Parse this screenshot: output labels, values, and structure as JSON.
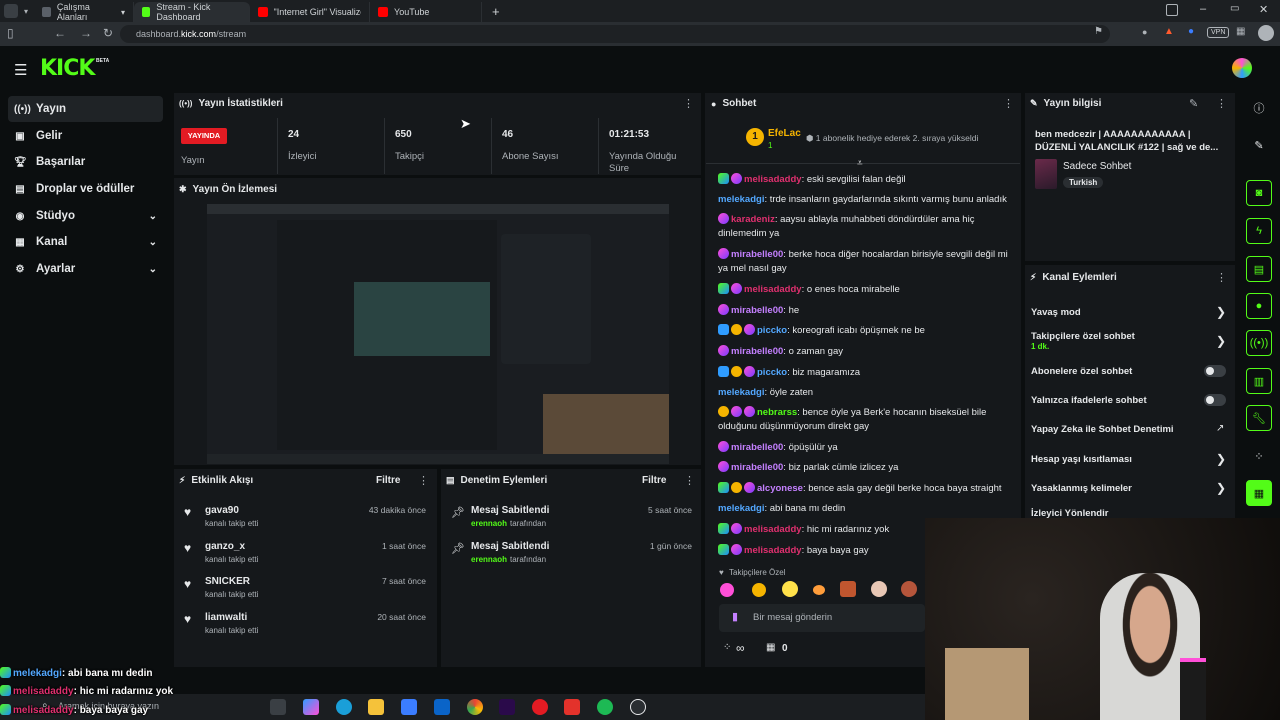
{
  "browser": {
    "tabs": [
      {
        "label": "Çalışma Alanları",
        "active": false
      },
      {
        "label": "Stream - Kick Dashboard",
        "active": true
      },
      {
        "label": "\"Internet Girl\" Visualizer | K",
        "active": false
      },
      {
        "label": "YouTube",
        "active": false
      }
    ],
    "url_prefix": "dashboard.",
    "url_domain": "kick.com",
    "url_path": "/stream",
    "vpn_label": "VPN"
  },
  "app": {
    "logo": "KICK",
    "beta": "BETA",
    "accent": "#53fc18"
  },
  "sidebar": {
    "items": [
      {
        "label": "Yayın",
        "icon": "broadcast-icon"
      },
      {
        "label": "Gelir",
        "icon": "wallet-icon"
      },
      {
        "label": "Başarılar",
        "icon": "trophy-icon"
      },
      {
        "label": "Droplar ve ödüller",
        "icon": "gift-icon"
      },
      {
        "label": "Stüdyo",
        "icon": "studio-icon"
      },
      {
        "label": "Kanal",
        "icon": "channel-icon"
      },
      {
        "label": "Ayarlar",
        "icon": "gear-icon"
      }
    ]
  },
  "stats": {
    "title": "Yayın İstatistikleri",
    "live_badge": "YAYINDA",
    "items": [
      {
        "value": "",
        "label": "Yayın"
      },
      {
        "value": "24",
        "label": "İzleyici"
      },
      {
        "value": "650",
        "label": "Takipçi"
      },
      {
        "value": "46",
        "label": "Abone Sayısı"
      },
      {
        "value": "01:21:53",
        "label": "Yayında Olduğu Süre"
      }
    ]
  },
  "preview": {
    "title": "Yayın Ön İzlemesi"
  },
  "activity": {
    "title": "Etkinlik Akışı",
    "filter": "Filtre",
    "items": [
      {
        "name": "gava90",
        "action": "kanalı takip etti",
        "time": "43 dakika önce"
      },
      {
        "name": "ganzo_x",
        "action": "kanalı takip etti",
        "time": "1 saat önce"
      },
      {
        "name": "SNICKER",
        "action": "kanalı takip etti",
        "time": "7 saat önce"
      },
      {
        "name": "liamwalti",
        "action": "kanalı takip etti",
        "time": "20 saat önce"
      }
    ]
  },
  "moderation": {
    "title": "Denetim Eylemleri",
    "filter": "Filtre",
    "items": [
      {
        "action": "Mesaj Sabitlendi",
        "user": "erennaoh",
        "suffix": "tarafından",
        "time": "5 saat önce"
      },
      {
        "action": "Mesaj Sabitlendi",
        "user": "erennaoh",
        "suffix": "tarafından",
        "time": "1 gün önce"
      }
    ]
  },
  "chat": {
    "title": "Sohbet",
    "pinned_user": "EfeLac",
    "pinned_count": "1",
    "pinned_text": "1 abonelik hediye ederek 2. sıraya yükseldi",
    "messages": [
      {
        "user": "melisadaddy",
        "color": "pink",
        "badges": [
          "b1",
          "b2"
        ],
        "text": "eski sevgilisi falan değil"
      },
      {
        "user": "melekadgi",
        "color": "blue",
        "badges": [],
        "text": "trde insanların gaydarlarında sıkıntı varmış bunu anladık"
      },
      {
        "user": "karadeniz",
        "color": "pink",
        "badges": [
          "b2"
        ],
        "text": "aaysu ablayla muhabbeti döndürdüler ama hiç dinlemedim ya"
      },
      {
        "user": "mirabelle00",
        "color": "purple",
        "badges": [
          "b2"
        ],
        "text": "berke hoca diğer hocalardan birisiyle sevgili değil mi ya mel nasıl gay"
      },
      {
        "user": "melisadaddy",
        "color": "pink",
        "badges": [
          "b1",
          "b2"
        ],
        "text": "o enes hoca mirabelle"
      },
      {
        "user": "mirabelle00",
        "color": "purple",
        "badges": [
          "b2"
        ],
        "text": "he"
      },
      {
        "user": "piccko",
        "color": "blue",
        "badges": [
          "b4",
          "b3",
          "b2"
        ],
        "text": "koreografi icabı öpüşmek ne be"
      },
      {
        "user": "mirabelle00",
        "color": "purple",
        "badges": [
          "b2"
        ],
        "text": "o zaman gay"
      },
      {
        "user": "piccko",
        "color": "blue",
        "badges": [
          "b4",
          "b3",
          "b2"
        ],
        "text": "biz magaramıza"
      },
      {
        "user": "melekadgi",
        "color": "blue",
        "badges": [],
        "text": "öyle zaten"
      },
      {
        "user": "nebrarss",
        "color": "green",
        "badges": [
          "b3",
          "b2",
          "b2"
        ],
        "text": "bence öyle ya Berk'e hocanın biseksüel bile olduğunu düşünmüyorum direkt gay"
      },
      {
        "user": "mirabelle00",
        "color": "purple",
        "badges": [
          "b2"
        ],
        "text": "öpüşülür ya"
      },
      {
        "user": "mirabelle00",
        "color": "purple",
        "badges": [
          "b2"
        ],
        "text": "biz parlak cümle izlicez ya"
      },
      {
        "user": "alcyonese",
        "color": "purple",
        "badges": [
          "b1",
          "b3",
          "b2"
        ],
        "text": "bence asla gay değil berke hoca baya straight"
      },
      {
        "user": "melekadgi",
        "color": "blue",
        "badges": [],
        "text": "abi bana mı dedin"
      },
      {
        "user": "melisadaddy",
        "color": "pink",
        "badges": [
          "b1",
          "b2"
        ],
        "text": "hic mi radarınız yok"
      },
      {
        "user": "melisadaddy",
        "color": "pink",
        "badges": [
          "b1",
          "b2"
        ],
        "text": "baya baya gay"
      }
    ],
    "emote_label": "Takipçilere Özel",
    "input_placeholder": "Bir mesaj gönderin",
    "footer_count": "0",
    "footer_infinity": "∞"
  },
  "stream_info": {
    "title": "Yayın bilgisi",
    "stream_title": "ben medcezir | AAAAAAAAAAAA | DÜZENLİ YALANCILIK #122 | sağ ve de...",
    "category": "Sadece Sohbet",
    "language": "Turkish"
  },
  "channel_actions": {
    "title": "Kanal Eylemleri",
    "items": [
      {
        "label": "Yavaş mod",
        "type": "arrow",
        "sub": ""
      },
      {
        "label": "Takipçilere özel sohbet",
        "type": "arrow",
        "sub": "1 dk."
      },
      {
        "label": "Abonelere özel sohbet",
        "type": "toggle",
        "sub": ""
      },
      {
        "label": "Yalnızca ifadelerle sohbet",
        "type": "toggle",
        "sub": ""
      },
      {
        "label": "Yapay Zeka ile Sohbet Denetimi",
        "type": "external",
        "sub": ""
      },
      {
        "label": "Hesap yaşı kısıtlaması",
        "type": "arrow",
        "sub": ""
      },
      {
        "label": "Yasaklanmış kelimeler",
        "type": "arrow",
        "sub": ""
      },
      {
        "label": "İzleyici Yönlendir",
        "type": "none",
        "sub": ""
      }
    ]
  },
  "overlay_chat": [
    {
      "user": "melekadgi",
      "text": ": abi bana mı dedin"
    },
    {
      "user": "melisadaddy",
      "text": ": hic mi radarınız yok"
    },
    {
      "user": "melisadaddy",
      "text": ": baya baya gay"
    }
  ],
  "taskbar": {
    "search_placeholder": "Aramak için buraya yazın"
  }
}
